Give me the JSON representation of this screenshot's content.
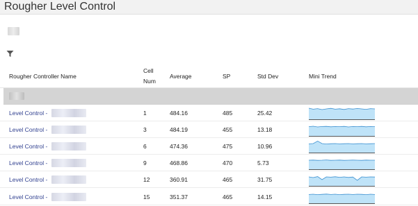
{
  "page": {
    "title": "Rougher Level Control"
  },
  "table": {
    "headers": {
      "name": "Rougher Controller Name",
      "cell_num_line1": "Cell",
      "cell_num_line2": "Num",
      "average": "Average",
      "sp": "SP",
      "std_dev": "Std Dev",
      "mini_trend": "Mini Trend"
    },
    "rows": [
      {
        "name": "Level Control -",
        "cell": "1",
        "average": "484.16",
        "sp": "485",
        "std_dev": "25.42"
      },
      {
        "name": "Level Control -",
        "cell": "3",
        "average": "484.19",
        "sp": "455",
        "std_dev": "13.18"
      },
      {
        "name": "Level Control -",
        "cell": "6",
        "average": "474.36",
        "sp": "475",
        "std_dev": "10.96"
      },
      {
        "name": "Level Control -",
        "cell": "9",
        "average": "468.86",
        "sp": "470",
        "std_dev": "5.73"
      },
      {
        "name": "Level Control -",
        "cell": "12",
        "average": "360.91",
        "sp": "465",
        "std_dev": "31.75"
      },
      {
        "name": "Level Control -",
        "cell": "15",
        "average": "351.37",
        "sp": "465",
        "std_dev": "14.15"
      }
    ]
  },
  "colors": {
    "trend_fill": "#bfe3f8",
    "trend_line": "#3a8fd0",
    "link": "#2f3f8f"
  },
  "icons": {
    "filter": "filter-icon"
  }
}
